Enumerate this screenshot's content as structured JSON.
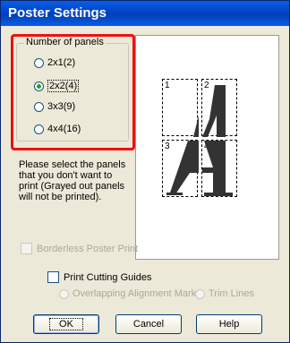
{
  "window": {
    "title": "Poster Settings"
  },
  "panels_group": {
    "legend": "Number of panels",
    "options": [
      {
        "label": "2x1(2)",
        "selected": false
      },
      {
        "label": "2x2(4)",
        "selected": true
      },
      {
        "label": "3x3(9)",
        "selected": false
      },
      {
        "label": "4x4(16)",
        "selected": false
      }
    ]
  },
  "description": "Please select the panels that you don't want to print (Grayed out panels will not be printed).",
  "preview": {
    "panel_numbers": [
      "1",
      "2",
      "3",
      "4"
    ]
  },
  "borderless": {
    "label": "Borderless Poster Print",
    "checked": false,
    "enabled": false
  },
  "cutting_guides": {
    "label": "Print Cutting Guides",
    "checked": false,
    "sub_options": [
      {
        "label": "Overlapping Alignment Marks",
        "enabled": false
      },
      {
        "label": "Trim Lines",
        "enabled": false
      }
    ]
  },
  "buttons": {
    "ok": "OK",
    "cancel": "Cancel",
    "help": "Help"
  }
}
